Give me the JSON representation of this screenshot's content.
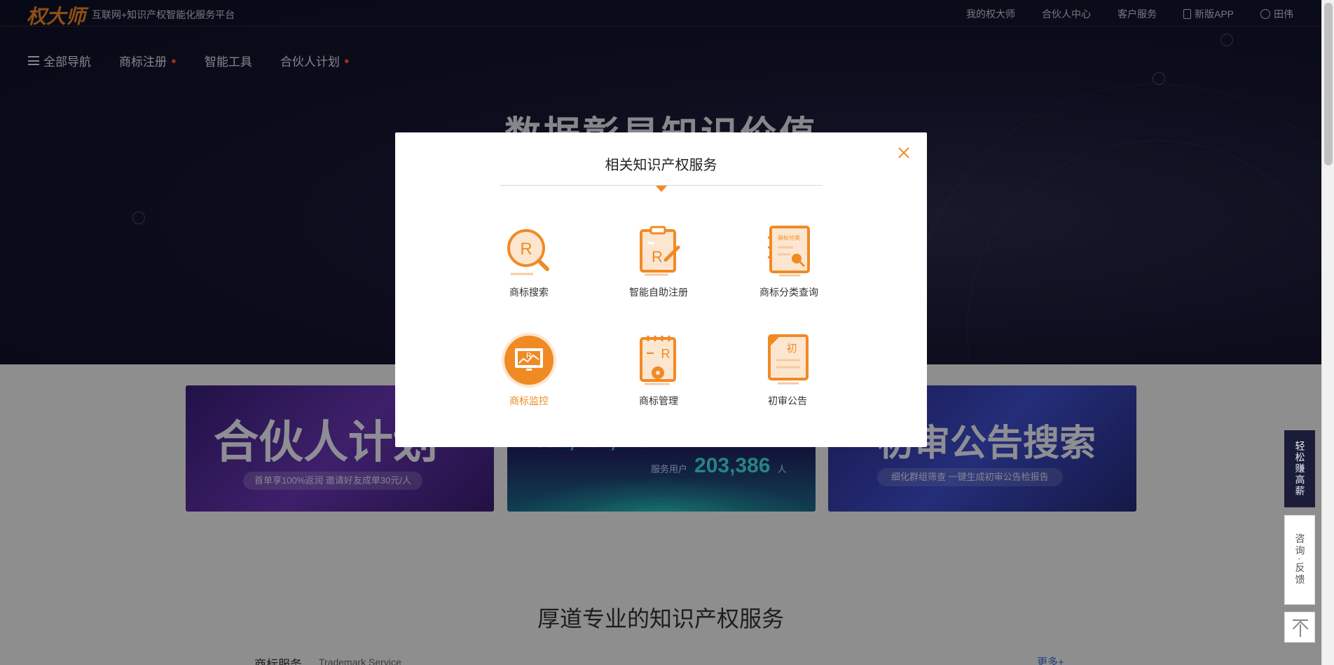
{
  "header": {
    "logo_text": "权大师",
    "slogan": "互联网+知识产权智能化服务平台",
    "links": [
      {
        "label": "我的权大师"
      },
      {
        "label": "合伙人中心"
      },
      {
        "label": "客户服务"
      },
      {
        "label": "新版APP"
      },
      {
        "label": "田伟"
      }
    ]
  },
  "nav": {
    "all_label": "全部导航",
    "items": [
      {
        "label": "商标注册",
        "hot": true
      },
      {
        "label": "智能工具",
        "hot": false
      },
      {
        "label": "合伙人计划",
        "hot": true
      }
    ]
  },
  "hero": {
    "title": "数据彰显知识价值"
  },
  "banners": {
    "partner": {
      "title": "合伙人计划",
      "pill": "首单享100%返润 邀请好友成单30元/人"
    },
    "stats": {
      "top_value": "300,204,420",
      "users_label": "服务用户",
      "users_value": "203,386",
      "users_unit": "人"
    },
    "search": {
      "title": "初审公告搜索",
      "sub": "细化群组筛查 一键生成初审公告检报告"
    }
  },
  "section": {
    "title": "厚道专业的知识产权服务",
    "service_label": "商标服务",
    "service_sub": "Trademark Service",
    "more": "更多+"
  },
  "side": {
    "earn": "轻松赚高薪",
    "consult": "咨询·反馈"
  },
  "modal": {
    "title": "相关知识产权服务",
    "items": [
      {
        "name": "商标搜索",
        "icon": "magnifier-r-icon",
        "active": false
      },
      {
        "name": "智能自助注册",
        "icon": "clipboard-r-pen-icon",
        "active": false
      },
      {
        "name": "商标分类查询",
        "icon": "notebook-search-icon",
        "active": false
      },
      {
        "name": "商标监控",
        "icon": "monitor-r-icon",
        "active": true
      },
      {
        "name": "商标管理",
        "icon": "notepad-gear-icon",
        "active": false
      },
      {
        "name": "初审公告",
        "icon": "bookmark-doc-icon",
        "active": false
      }
    ],
    "icon_text": {
      "r": "R",
      "chu": "初",
      "class_tag": "商标分类"
    }
  },
  "colors": {
    "accent": "#f08a25",
    "dark_bg": "#161733"
  }
}
